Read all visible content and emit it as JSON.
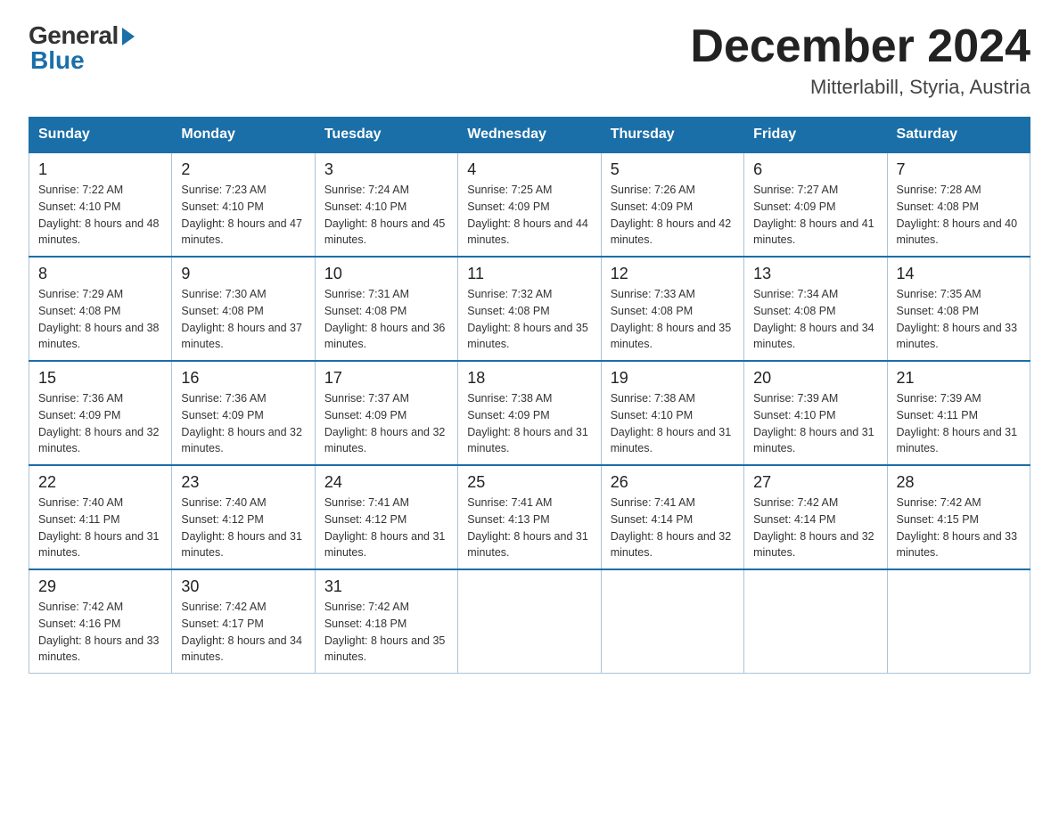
{
  "logo": {
    "general": "General",
    "blue": "Blue"
  },
  "title": "December 2024",
  "location": "Mitterlabill, Styria, Austria",
  "headers": [
    "Sunday",
    "Monday",
    "Tuesday",
    "Wednesday",
    "Thursday",
    "Friday",
    "Saturday"
  ],
  "weeks": [
    [
      {
        "day": "1",
        "sunrise": "7:22 AM",
        "sunset": "4:10 PM",
        "daylight": "8 hours and 48 minutes."
      },
      {
        "day": "2",
        "sunrise": "7:23 AM",
        "sunset": "4:10 PM",
        "daylight": "8 hours and 47 minutes."
      },
      {
        "day": "3",
        "sunrise": "7:24 AM",
        "sunset": "4:10 PM",
        "daylight": "8 hours and 45 minutes."
      },
      {
        "day": "4",
        "sunrise": "7:25 AM",
        "sunset": "4:09 PM",
        "daylight": "8 hours and 44 minutes."
      },
      {
        "day": "5",
        "sunrise": "7:26 AM",
        "sunset": "4:09 PM",
        "daylight": "8 hours and 42 minutes."
      },
      {
        "day": "6",
        "sunrise": "7:27 AM",
        "sunset": "4:09 PM",
        "daylight": "8 hours and 41 minutes."
      },
      {
        "day": "7",
        "sunrise": "7:28 AM",
        "sunset": "4:08 PM",
        "daylight": "8 hours and 40 minutes."
      }
    ],
    [
      {
        "day": "8",
        "sunrise": "7:29 AM",
        "sunset": "4:08 PM",
        "daylight": "8 hours and 38 minutes."
      },
      {
        "day": "9",
        "sunrise": "7:30 AM",
        "sunset": "4:08 PM",
        "daylight": "8 hours and 37 minutes."
      },
      {
        "day": "10",
        "sunrise": "7:31 AM",
        "sunset": "4:08 PM",
        "daylight": "8 hours and 36 minutes."
      },
      {
        "day": "11",
        "sunrise": "7:32 AM",
        "sunset": "4:08 PM",
        "daylight": "8 hours and 35 minutes."
      },
      {
        "day": "12",
        "sunrise": "7:33 AM",
        "sunset": "4:08 PM",
        "daylight": "8 hours and 35 minutes."
      },
      {
        "day": "13",
        "sunrise": "7:34 AM",
        "sunset": "4:08 PM",
        "daylight": "8 hours and 34 minutes."
      },
      {
        "day": "14",
        "sunrise": "7:35 AM",
        "sunset": "4:08 PM",
        "daylight": "8 hours and 33 minutes."
      }
    ],
    [
      {
        "day": "15",
        "sunrise": "7:36 AM",
        "sunset": "4:09 PM",
        "daylight": "8 hours and 32 minutes."
      },
      {
        "day": "16",
        "sunrise": "7:36 AM",
        "sunset": "4:09 PM",
        "daylight": "8 hours and 32 minutes."
      },
      {
        "day": "17",
        "sunrise": "7:37 AM",
        "sunset": "4:09 PM",
        "daylight": "8 hours and 32 minutes."
      },
      {
        "day": "18",
        "sunrise": "7:38 AM",
        "sunset": "4:09 PM",
        "daylight": "8 hours and 31 minutes."
      },
      {
        "day": "19",
        "sunrise": "7:38 AM",
        "sunset": "4:10 PM",
        "daylight": "8 hours and 31 minutes."
      },
      {
        "day": "20",
        "sunrise": "7:39 AM",
        "sunset": "4:10 PM",
        "daylight": "8 hours and 31 minutes."
      },
      {
        "day": "21",
        "sunrise": "7:39 AM",
        "sunset": "4:11 PM",
        "daylight": "8 hours and 31 minutes."
      }
    ],
    [
      {
        "day": "22",
        "sunrise": "7:40 AM",
        "sunset": "4:11 PM",
        "daylight": "8 hours and 31 minutes."
      },
      {
        "day": "23",
        "sunrise": "7:40 AM",
        "sunset": "4:12 PM",
        "daylight": "8 hours and 31 minutes."
      },
      {
        "day": "24",
        "sunrise": "7:41 AM",
        "sunset": "4:12 PM",
        "daylight": "8 hours and 31 minutes."
      },
      {
        "day": "25",
        "sunrise": "7:41 AM",
        "sunset": "4:13 PM",
        "daylight": "8 hours and 31 minutes."
      },
      {
        "day": "26",
        "sunrise": "7:41 AM",
        "sunset": "4:14 PM",
        "daylight": "8 hours and 32 minutes."
      },
      {
        "day": "27",
        "sunrise": "7:42 AM",
        "sunset": "4:14 PM",
        "daylight": "8 hours and 32 minutes."
      },
      {
        "day": "28",
        "sunrise": "7:42 AM",
        "sunset": "4:15 PM",
        "daylight": "8 hours and 33 minutes."
      }
    ],
    [
      {
        "day": "29",
        "sunrise": "7:42 AM",
        "sunset": "4:16 PM",
        "daylight": "8 hours and 33 minutes."
      },
      {
        "day": "30",
        "sunrise": "7:42 AM",
        "sunset": "4:17 PM",
        "daylight": "8 hours and 34 minutes."
      },
      {
        "day": "31",
        "sunrise": "7:42 AM",
        "sunset": "4:18 PM",
        "daylight": "8 hours and 35 minutes."
      },
      null,
      null,
      null,
      null
    ]
  ]
}
